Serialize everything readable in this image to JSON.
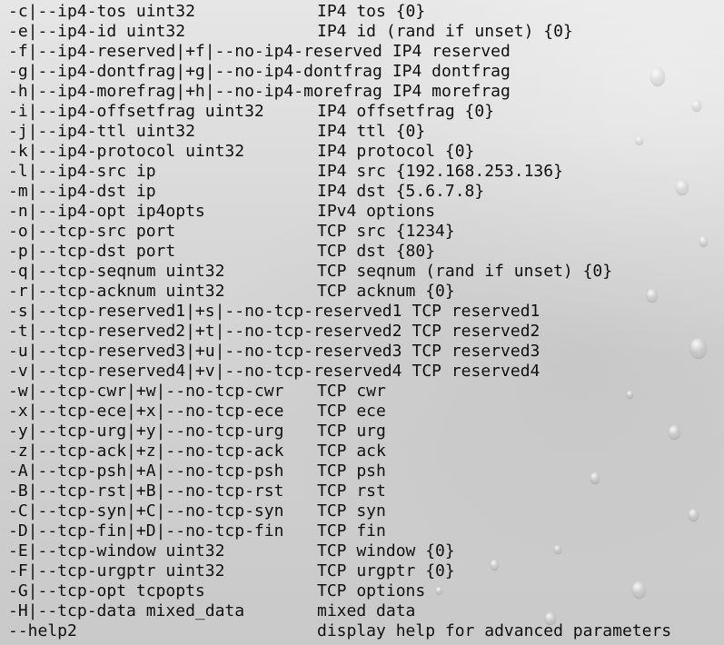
{
  "help_lines": [
    {
      "option": "-c|--ip4-tos uint32",
      "description": "IP4 tos {0}"
    },
    {
      "option": "-e|--ip4-id uint32",
      "description": "IP4 id (rand if unset) {0}"
    },
    {
      "option": "-f|--ip4-reserved|+f|--no-ip4-reserved",
      "description": "IP4 reserved"
    },
    {
      "option": "-g|--ip4-dontfrag|+g|--no-ip4-dontfrag",
      "description": "IP4 dontfrag"
    },
    {
      "option": "-h|--ip4-morefrag|+h|--no-ip4-morefrag",
      "description": "IP4 morefrag"
    },
    {
      "option": "-i|--ip4-offsetfrag uint32",
      "description": "IP4 offsetfrag {0}"
    },
    {
      "option": "-j|--ip4-ttl uint32",
      "description": "IP4 ttl {0}"
    },
    {
      "option": "-k|--ip4-protocol uint32",
      "description": "IP4 protocol {0}"
    },
    {
      "option": "-l|--ip4-src ip",
      "description": "IP4 src {192.168.253.136}"
    },
    {
      "option": "-m|--ip4-dst ip",
      "description": "IP4 dst {5.6.7.8}"
    },
    {
      "option": "-n|--ip4-opt ip4opts",
      "description": "IPv4 options"
    },
    {
      "option": "-o|--tcp-src port",
      "description": "TCP src {1234}"
    },
    {
      "option": "-p|--tcp-dst port",
      "description": "TCP dst {80}"
    },
    {
      "option": "-q|--tcp-seqnum uint32",
      "description": "TCP seqnum (rand if unset) {0}"
    },
    {
      "option": "-r|--tcp-acknum uint32",
      "description": "TCP acknum {0}"
    },
    {
      "option": "-s|--tcp-reserved1|+s|--no-tcp-reserved1",
      "description": "TCP reserved1"
    },
    {
      "option": "-t|--tcp-reserved2|+t|--no-tcp-reserved2",
      "description": "TCP reserved2"
    },
    {
      "option": "-u|--tcp-reserved3|+u|--no-tcp-reserved3",
      "description": "TCP reserved3"
    },
    {
      "option": "-v|--tcp-reserved4|+v|--no-tcp-reserved4",
      "description": "TCP reserved4"
    },
    {
      "option": "-w|--tcp-cwr|+w|--no-tcp-cwr",
      "description": "TCP cwr"
    },
    {
      "option": "-x|--tcp-ece|+x|--no-tcp-ece",
      "description": "TCP ece"
    },
    {
      "option": "-y|--tcp-urg|+y|--no-tcp-urg",
      "description": "TCP urg"
    },
    {
      "option": "-z|--tcp-ack|+z|--no-tcp-ack",
      "description": "TCP ack"
    },
    {
      "option": "-A|--tcp-psh|+A|--no-tcp-psh",
      "description": "TCP psh"
    },
    {
      "option": "-B|--tcp-rst|+B|--no-tcp-rst",
      "description": "TCP rst"
    },
    {
      "option": "-C|--tcp-syn|+C|--no-tcp-syn",
      "description": "TCP syn"
    },
    {
      "option": "-D|--tcp-fin|+D|--no-tcp-fin",
      "description": "TCP fin"
    },
    {
      "option": "-E|--tcp-window uint32",
      "description": "TCP window {0}"
    },
    {
      "option": "-F|--tcp-urgptr uint32",
      "description": "TCP urgptr {0}"
    },
    {
      "option": "-G|--tcp-opt tcpopts",
      "description": "TCP options"
    },
    {
      "option": "-H|--tcp-data mixed_data",
      "description": "mixed data"
    },
    {
      "option": "--help2",
      "description": "display help for advanced parameters"
    }
  ]
}
